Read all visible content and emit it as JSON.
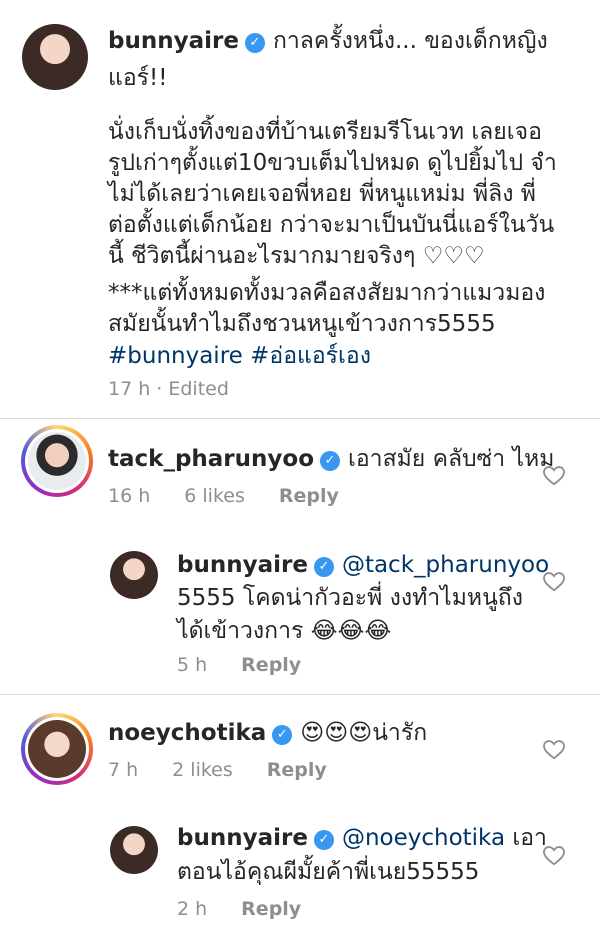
{
  "caption": {
    "username": "bunnyaire",
    "line1": "กาลครั้งหนึ่ง... ของเด็กหญิง",
    "line2": "แอร์!!",
    "body": [
      "นั่งเก็บนั่งทิ้งของที่บ้านเตรียมรีโนเวท เลยเจอ",
      "รูปเก่าๆตั้งแต่10ขวบเต็มไปหมด ดูไปยิ้มไป จำ",
      "ไม่ได้เลยว่าเคยเจอพี่หอย พี่หนูแหม่ม พี่ลิง พี่",
      "ต่อตั้งแต่เด็กน้อย กว่าจะมาเป็นบันนี่แอร์ในวัน",
      "นี้ ชีวิตนี้ผ่านอะไรมากมายจริงๆ ♡♡♡",
      "***แต่ทั้งหมดทั้งมวลคือสงสัยมากว่าแมวมอง",
      "สมัยนั้นทำไมถึงชวนหนูเข้าวงการ5555"
    ],
    "hashtag1": "#bunnyaire",
    "hashtag2": "#อ่อแอร์เอง",
    "time": "17 h",
    "edited": "· Edited"
  },
  "comments": [
    {
      "username": "tack_pharunyoo",
      "text": "เอาสมัย คลับซ่า ไหม",
      "time": "16 h",
      "likes": "6 likes",
      "reply_label": "Reply",
      "replies": [
        {
          "username": "bunnyaire",
          "mention": "@tack_pharunyoo",
          "line1": "5555 โคดน่ากัวอะพี่ งงทำไมหนูถึง",
          "line2": "ได้เข้าวงการ 😂😂😂",
          "time": "5 h",
          "reply_label": "Reply"
        }
      ]
    },
    {
      "username": "noeychotika",
      "text": "😍😍😍น่ารัก",
      "time": "7 h",
      "likes": "2 likes",
      "reply_label": "Reply",
      "replies": [
        {
          "username": "bunnyaire",
          "mention": "@noeychotika",
          "mention_after": " เอา",
          "line1": "ตอนไอ้คุณผีมั้ยค้าพี่เนย55555",
          "time": "2 h",
          "reply_label": "Reply"
        }
      ]
    }
  ],
  "icons": {
    "verified": "verified-badge-icon",
    "like": "heart-outline-icon"
  },
  "colors": {
    "verified": "#3897f0",
    "link": "#003569",
    "meta": "#8e8e8e"
  }
}
